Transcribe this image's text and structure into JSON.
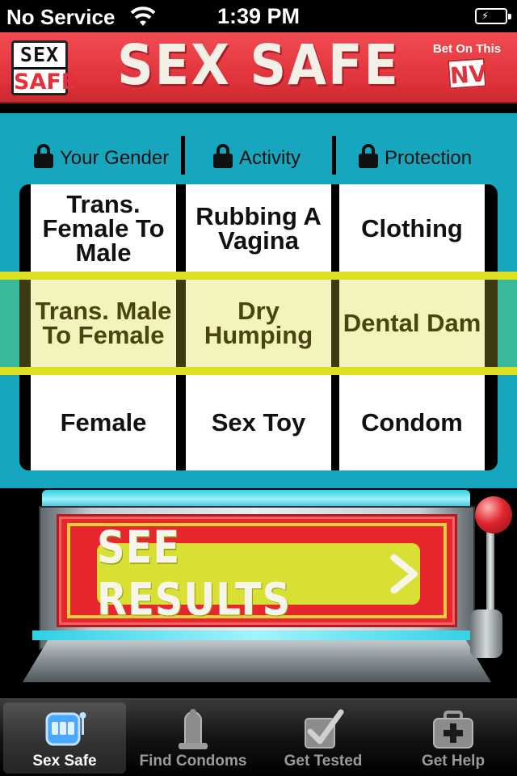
{
  "status_bar": {
    "carrier": "No Service",
    "time": "1:39 PM",
    "wifi_icon": "wifi-icon",
    "battery_icon": "battery-charging-icon"
  },
  "header": {
    "logo": {
      "line1": "SEX",
      "line2": "SAFE"
    },
    "title": "SEX SAFE",
    "bet": {
      "text": "Bet On This",
      "badge": "NV"
    }
  },
  "columns": [
    {
      "label": "Your Gender",
      "icon": "lock-icon"
    },
    {
      "label": "Activity",
      "icon": "lock-icon"
    },
    {
      "label": "Protection",
      "icon": "lock-icon"
    }
  ],
  "reels": {
    "gender": {
      "above": "Trans. Female To Male",
      "selected": "Trans. Male To Female",
      "below": "Female"
    },
    "activity": {
      "above": "Rubbing A Vagina",
      "selected": "Dry Humping",
      "below": "Sex Toy"
    },
    "protection": {
      "above": "Clothing",
      "selected": "Dental Dam",
      "below": "Condom"
    }
  },
  "results_button": {
    "label": "SEE RESULTS",
    "icon": "chevron-right-icon"
  },
  "tabs": [
    {
      "label": "Sex Safe",
      "icon": "slot-machine-icon",
      "active": true
    },
    {
      "label": "Find Condoms",
      "icon": "condom-icon",
      "active": false
    },
    {
      "label": "Get Tested",
      "icon": "checkbox-icon",
      "active": false
    },
    {
      "label": "Get Help",
      "icon": "first-aid-kit-icon",
      "active": false
    }
  ],
  "colors": {
    "header_red": "#e0323a",
    "panel_teal": "#16a6be",
    "highlight_yellow": "#dbe121",
    "button_yellow": "#d7e033",
    "screen_red": "#e8262e"
  }
}
